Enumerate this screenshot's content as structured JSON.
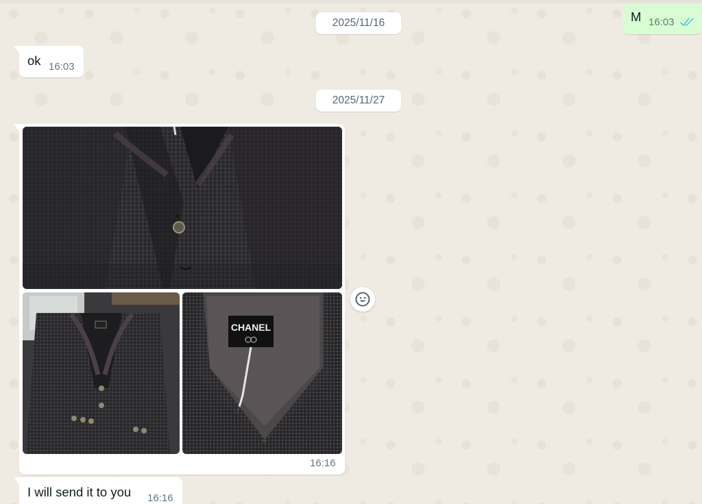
{
  "dates": [
    "2025/11/16",
    "2025/11/27"
  ],
  "messages": {
    "out_m": {
      "text": "M",
      "time": "16:03",
      "status_icon": "double-check-read-icon"
    },
    "in_ok": {
      "text": "ok",
      "time": "16:03"
    },
    "album": {
      "time": "16:16",
      "photos": [
        "jacket-front-photo",
        "jacket-full-photo",
        "chanel-label-photo"
      ],
      "label_text": "CHANEL"
    },
    "in_last": {
      "text": "I will send it to you",
      "time": "16:16"
    }
  },
  "react_icon": "emoji-smile-icon",
  "colors": {
    "background": "#efeae2",
    "incoming_bubble": "#ffffff",
    "outgoing_bubble": "#d9fdd3",
    "read_check": "#53bdeb",
    "timestamp": "#667781"
  }
}
